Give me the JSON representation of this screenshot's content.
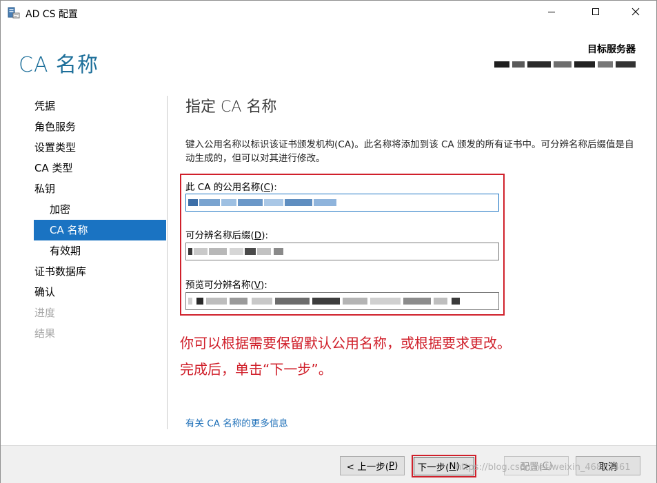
{
  "window": {
    "title": "AD CS 配置",
    "controls": {
      "minimize": "minimize",
      "maximize": "maximize",
      "close": "close"
    }
  },
  "header": {
    "page_title": "CA 名称",
    "target_label": "目标服务器"
  },
  "nav": {
    "items": [
      {
        "label": "凭据",
        "level": 0,
        "state": "normal"
      },
      {
        "label": "角色服务",
        "level": 0,
        "state": "normal"
      },
      {
        "label": "设置类型",
        "level": 0,
        "state": "normal"
      },
      {
        "label": "CA 类型",
        "level": 0,
        "state": "normal"
      },
      {
        "label": "私钥",
        "level": 0,
        "state": "normal"
      },
      {
        "label": "加密",
        "level": 1,
        "state": "normal"
      },
      {
        "label": "CA 名称",
        "level": 1,
        "state": "selected"
      },
      {
        "label": "有效期",
        "level": 1,
        "state": "normal"
      },
      {
        "label": "证书数据库",
        "level": 0,
        "state": "normal"
      },
      {
        "label": "确认",
        "level": 0,
        "state": "normal"
      },
      {
        "label": "进度",
        "level": 0,
        "state": "disabled"
      },
      {
        "label": "结果",
        "level": 0,
        "state": "disabled"
      }
    ]
  },
  "main": {
    "section_title": "指定 CA 名称",
    "description": "键入公用名称以标识该证书颁发机构(CA)。此名称将添加到该 CA 颁发的所有证书中。可分辨名称后缀值是自动生成的，但可以对其进行修改。",
    "fields": {
      "common_name": {
        "label_pre": "此 CA 的公用名称(",
        "accel": "C",
        "label_post": "):"
      },
      "dn_suffix": {
        "label_pre": "可分辨名称后缀(",
        "accel": "D",
        "label_post": "):"
      },
      "preview_dn": {
        "label_pre": "预览可分辨名称(",
        "accel": "V",
        "label_post": "):"
      }
    },
    "annotation_line1": "你可以根据需要保留默认公用名称，或根据要求更改。",
    "annotation_line2": "完成后，单击“下一步”。",
    "more_info_link": "有关 CA 名称的更多信息"
  },
  "footer": {
    "back": {
      "pre": "< 上一步(",
      "accel": "P",
      "post": ")"
    },
    "next": {
      "pre": "下一步(",
      "accel": "N",
      "post": ") >"
    },
    "configure": {
      "pre": "配置(",
      "accel": "C",
      "post": ")"
    },
    "cancel": "取消"
  },
  "watermark": "https://blog.csdn.net/weixin_46883461",
  "colors": {
    "accent": "#1a73c2",
    "header_title": "#1d6f9a",
    "annotation_red": "#d0202b",
    "link": "#1d6fb8"
  },
  "icons": {
    "app": "server-certificate-icon",
    "minimize": "minimize-icon",
    "maximize": "maximize-icon",
    "close": "close-icon"
  }
}
